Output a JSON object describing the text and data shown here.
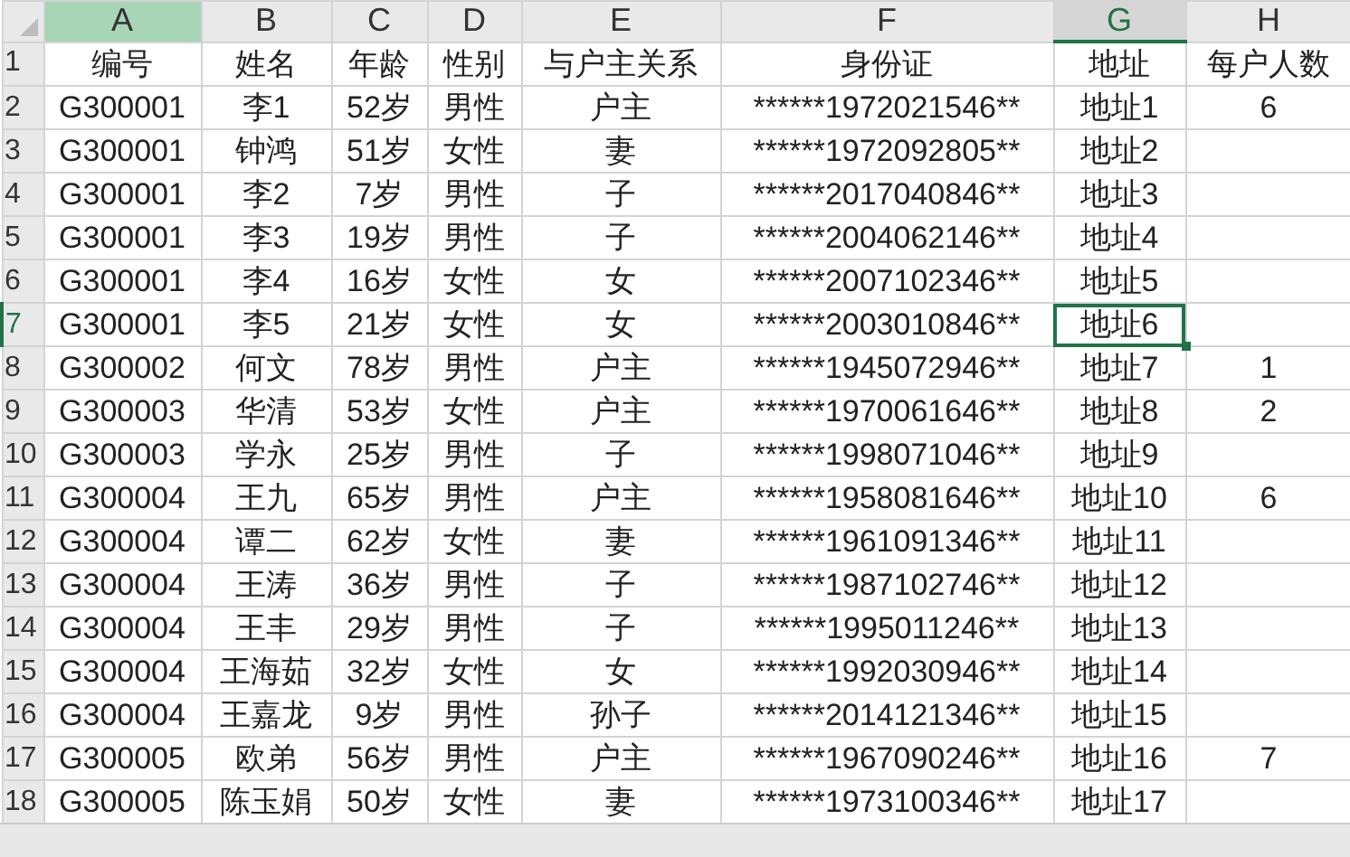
{
  "columns": [
    {
      "letter": "A",
      "selected": false,
      "filled": true
    },
    {
      "letter": "B",
      "selected": false,
      "filled": false
    },
    {
      "letter": "C",
      "selected": false,
      "filled": false
    },
    {
      "letter": "D",
      "selected": false,
      "filled": false
    },
    {
      "letter": "E",
      "selected": false,
      "filled": false
    },
    {
      "letter": "F",
      "selected": false,
      "filled": false
    },
    {
      "letter": "G",
      "selected": true,
      "filled": false
    },
    {
      "letter": "H",
      "selected": false,
      "filled": false
    }
  ],
  "rows": [
    {
      "number": "1",
      "selected": false,
      "cells": {
        "A": "编号",
        "B": "姓名",
        "C": "年龄",
        "D": "性别",
        "E": "与户主关系",
        "F": "身份证",
        "G": "地址",
        "H": "每户人数"
      }
    },
    {
      "number": "2",
      "selected": false,
      "cells": {
        "A": "G300001",
        "B": "李1",
        "C": "52岁",
        "D": "男性",
        "E": "户主",
        "F": "******1972021546**",
        "G": "地址1",
        "H": "6"
      }
    },
    {
      "number": "3",
      "selected": false,
      "cells": {
        "A": "G300001",
        "B": "钟鸿",
        "C": "51岁",
        "D": "女性",
        "E": "妻",
        "F": "******1972092805**",
        "G": "地址2"
      }
    },
    {
      "number": "4",
      "selected": false,
      "cells": {
        "A": "G300001",
        "B": "李2",
        "C": "7岁",
        "D": "男性",
        "E": "子",
        "F": "******2017040846**",
        "G": "地址3"
      }
    },
    {
      "number": "5",
      "selected": false,
      "cells": {
        "A": "G300001",
        "B": "李3",
        "C": "19岁",
        "D": "男性",
        "E": "子",
        "F": "******2004062146**",
        "G": "地址4"
      }
    },
    {
      "number": "6",
      "selected": false,
      "cells": {
        "A": "G300001",
        "B": "李4",
        "C": "16岁",
        "D": "女性",
        "E": "女",
        "F": "******2007102346**",
        "G": "地址5"
      }
    },
    {
      "number": "7",
      "selected": true,
      "cells": {
        "A": "G300001",
        "B": "李5",
        "C": "21岁",
        "D": "女性",
        "E": "女",
        "F": "******2003010846**",
        "G": "地址6"
      }
    },
    {
      "number": "8",
      "selected": false,
      "cells": {
        "A": "G300002",
        "B": "何文",
        "C": "78岁",
        "D": "男性",
        "E": "户主",
        "F": "******1945072946**",
        "G": "地址7",
        "H": "1"
      }
    },
    {
      "number": "9",
      "selected": false,
      "cells": {
        "A": "G300003",
        "B": "华清",
        "C": "53岁",
        "D": "女性",
        "E": "户主",
        "F": "******1970061646**",
        "G": "地址8",
        "H": "2"
      }
    },
    {
      "number": "10",
      "selected": false,
      "cells": {
        "A": "G300003",
        "B": "学永",
        "C": "25岁",
        "D": "男性",
        "E": "子",
        "F": "******1998071046**",
        "G": "地址9"
      }
    },
    {
      "number": "11",
      "selected": false,
      "cells": {
        "A": "G300004",
        "B": "王九",
        "C": "65岁",
        "D": "男性",
        "E": "户主",
        "F": "******1958081646**",
        "G": "地址10",
        "H": "6"
      }
    },
    {
      "number": "12",
      "selected": false,
      "cells": {
        "A": "G300004",
        "B": "谭二",
        "C": "62岁",
        "D": "女性",
        "E": "妻",
        "F": "******1961091346**",
        "G": "地址11"
      }
    },
    {
      "number": "13",
      "selected": false,
      "cells": {
        "A": "G300004",
        "B": "王涛",
        "C": "36岁",
        "D": "男性",
        "E": "子",
        "F": "******1987102746**",
        "G": "地址12"
      }
    },
    {
      "number": "14",
      "selected": false,
      "cells": {
        "A": "G300004",
        "B": "王丰",
        "C": "29岁",
        "D": "男性",
        "E": "子",
        "F": "******1995011246**",
        "G": "地址13"
      }
    },
    {
      "number": "15",
      "selected": false,
      "cells": {
        "A": "G300004",
        "B": "王海茹",
        "C": "32岁",
        "D": "女性",
        "E": "女",
        "F": "******1992030946**",
        "G": "地址14"
      }
    },
    {
      "number": "16",
      "selected": false,
      "cells": {
        "A": "G300004",
        "B": "王嘉龙",
        "C": "9岁",
        "D": "男性",
        "E": "孙子",
        "F": "******2014121346**",
        "G": "地址15"
      }
    },
    {
      "number": "17",
      "selected": false,
      "cells": {
        "A": "G300005",
        "B": "欧弟",
        "C": "56岁",
        "D": "男性",
        "E": "户主",
        "F": "******1967090246**",
        "G": "地址16",
        "H": "7"
      }
    },
    {
      "number": "18",
      "selected": false,
      "cells": {
        "A": "G300005",
        "B": "陈玉娟",
        "C": "50岁",
        "D": "女性",
        "E": "妻",
        "F": "******1973100346**",
        "G": "地址17"
      }
    }
  ]
}
